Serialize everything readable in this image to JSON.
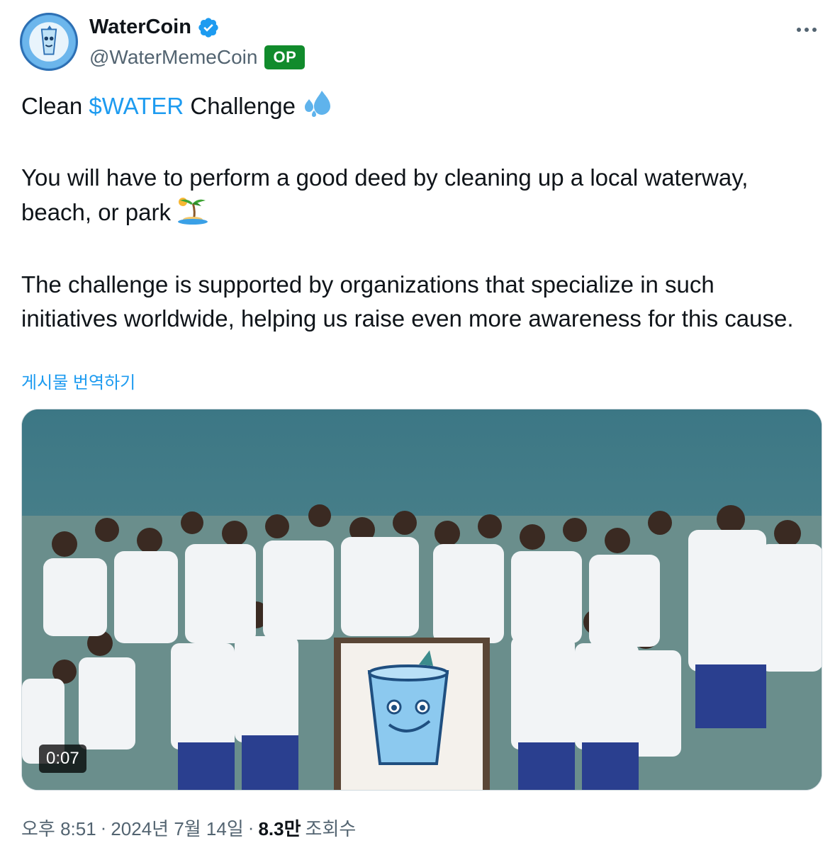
{
  "account": {
    "display_name": "WaterCoin",
    "handle": "@WaterMemeCoin",
    "badge": "OP",
    "verified": true
  },
  "tweet": {
    "line1_prefix": "Clean ",
    "line1_hashtag": "$WATER",
    "line1_suffix": " Challenge",
    "paragraph2": "You will have to perform a good deed by cleaning up a local waterway, beach, or park",
    "paragraph3": "The challenge is supported by organizations that specialize in such initiatives worldwide, helping us raise even more awareness for this cause.",
    "emoji1": "sweat-droplets-icon",
    "emoji2": "desert-island-icon"
  },
  "translate_label": "게시물 번역하기",
  "media": {
    "duration": "0:07"
  },
  "meta": {
    "time": "오후 8:51",
    "separator1": "·",
    "date": "2024년 7월 14일",
    "separator2": "·",
    "views_count": "8.3만",
    "views_label": "조회수"
  },
  "colors": {
    "link": "#1d9bf0",
    "op_badge": "#118b2c",
    "secondary_text": "#536471"
  }
}
